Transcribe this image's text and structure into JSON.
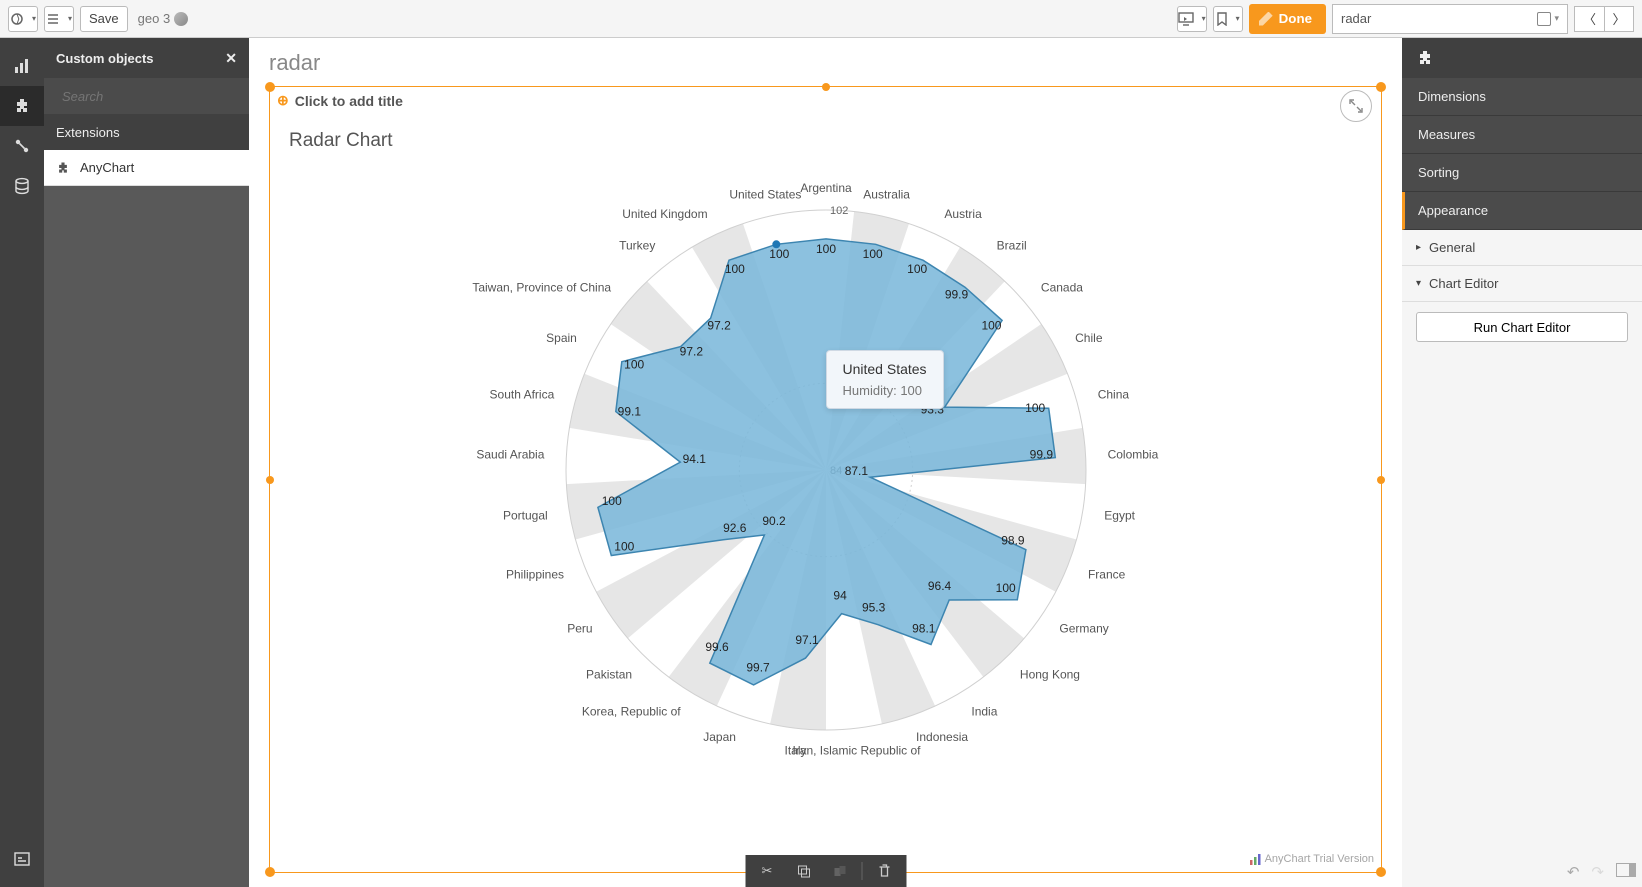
{
  "toolbar": {
    "save_label": "Save",
    "sheet_name": "geo 3",
    "done_label": "Done",
    "object_title": "radar"
  },
  "left_panel": {
    "title": "Custom objects",
    "search_placeholder": "Search",
    "section_label": "Extensions",
    "items": [
      {
        "label": "AnyChart"
      }
    ]
  },
  "canvas": {
    "sheet_title": "radar",
    "add_title_hint": "Click to add title",
    "chart_title": "Radar Chart",
    "watermark": "AnyChart Trial Version",
    "tooltip": {
      "title": "United States",
      "metric": "Humidity:",
      "value": "100"
    }
  },
  "right_panel": {
    "sections": [
      {
        "id": "dimensions",
        "label": "Dimensions"
      },
      {
        "id": "measures",
        "label": "Measures"
      },
      {
        "id": "sorting",
        "label": "Sorting"
      },
      {
        "id": "appearance",
        "label": "Appearance",
        "active": true
      }
    ],
    "accordions": [
      {
        "label": "General",
        "open": false
      },
      {
        "label": "Chart Editor",
        "open": true
      }
    ],
    "run_button": "Run Chart Editor"
  },
  "chart_data": {
    "type": "radar",
    "title": "Radar Chart",
    "metric": "Humidity",
    "rlim": [
      84,
      102
    ],
    "ticks": [
      84,
      90,
      102
    ],
    "categories": [
      "Argentina",
      "Australia",
      "Austria",
      "Brazil",
      "Canada",
      "Chile",
      "China",
      "Colombia",
      "Egypt",
      "France",
      "Germany",
      "Hong Kong",
      "India",
      "Indonesia",
      "Iran, Islamic Republic of",
      "Italy",
      "Japan",
      "Korea, Republic of",
      "Pakistan",
      "Peru",
      "Philippines",
      "Portugal",
      "Saudi Arabia",
      "South Africa",
      "Spain",
      "Taiwan, Province of China",
      "Turkey",
      "United Kingdom",
      "United States"
    ],
    "values": [
      100,
      100,
      100,
      99.9,
      100,
      93.3,
      100,
      99.9,
      87.1,
      98.9,
      100,
      96.4,
      98.1,
      95.3,
      94,
      97.1,
      99.7,
      99.6,
      90.2,
      92.6,
      100,
      100,
      94.1,
      99.1,
      100,
      97.2,
      97.2,
      100,
      100
    ]
  }
}
